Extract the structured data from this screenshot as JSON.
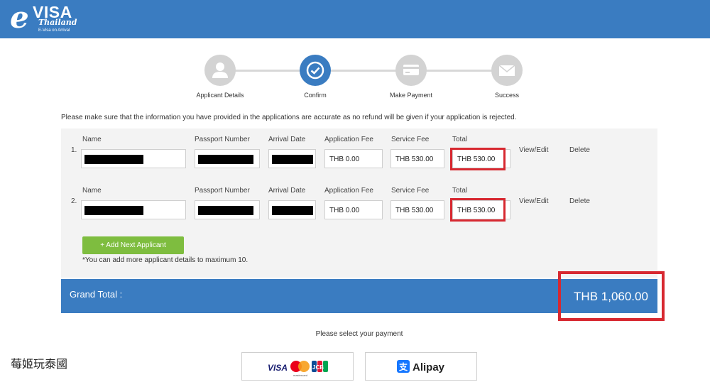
{
  "header": {
    "logo_e": "e",
    "logo_visa": "VISA",
    "logo_thailand": "Thailand",
    "logo_subtitle": "E-Visa on Arrival",
    "bar_color": "#3a7cc1"
  },
  "steps": [
    {
      "label": "Applicant Details",
      "icon": "user-icon",
      "state": "done"
    },
    {
      "label": "Confirm",
      "icon": "check-circle-icon",
      "state": "active"
    },
    {
      "label": "Make Payment",
      "icon": "credit-card-icon",
      "state": "pending"
    },
    {
      "label": "Success",
      "icon": "envelope-icon",
      "state": "pending"
    }
  ],
  "notice": "Please make sure that the information you have provided in the applications are accurate as no refund will be given if your application is rejected.",
  "columns": {
    "name": "Name",
    "passport": "Passport Number",
    "arrival": "Arrival Date",
    "app_fee": "Application Fee",
    "service_fee": "Service Fee",
    "total": "Total"
  },
  "applicants": [
    {
      "num": "1.",
      "app_fee": "THB 0.00",
      "service_fee": "THB 530.00",
      "total": "THB 530.00",
      "view": "View/Edit",
      "delete": "Delete"
    },
    {
      "num": "2.",
      "app_fee": "THB 0.00",
      "service_fee": "THB 530.00",
      "total": "THB 530.00",
      "view": "View/Edit",
      "delete": "Delete"
    }
  ],
  "add_button": "+ Add Next Applicant",
  "add_note": "*You can add more applicant details to maximum 10.",
  "grand_total": {
    "label": "Grand Total :",
    "value": "THB 1,060.00"
  },
  "payment": {
    "prompt": "Please select your payment",
    "options": [
      {
        "name": "VISA",
        "sub": "mastercard",
        "extra": "JCB"
      },
      {
        "name": "Alipay"
      }
    ]
  },
  "caption": "莓姬玩泰國",
  "highlight_color": "#d72830",
  "accent_color": "#3a7cc1",
  "button_color": "#7ebd3f"
}
